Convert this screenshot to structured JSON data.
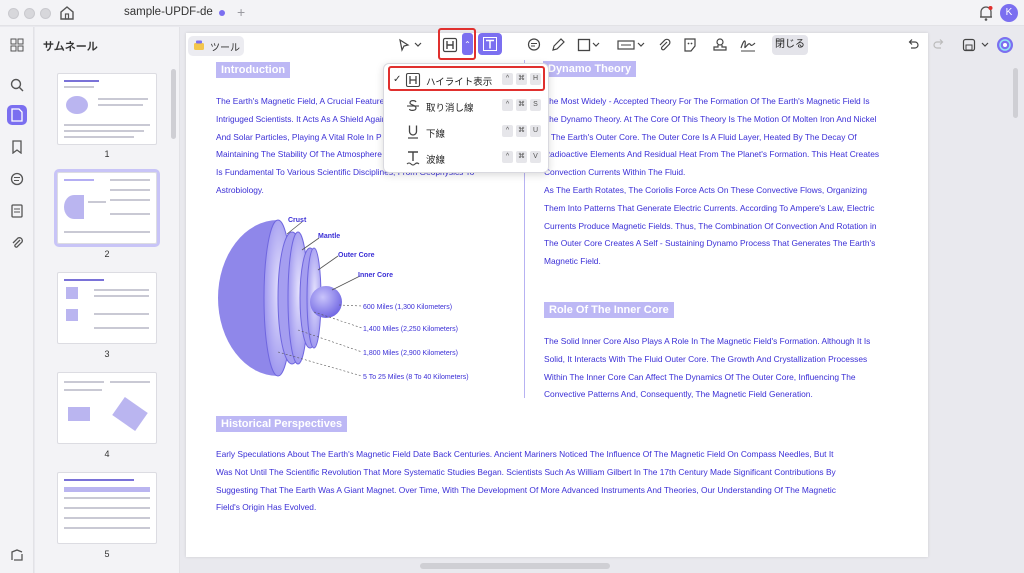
{
  "window": {
    "tab_title": "sample-UPDF-de",
    "avatar_letter": "K"
  },
  "sidebar": {
    "title": "サムネール",
    "pages": [
      "1",
      "2",
      "3",
      "4",
      "5"
    ]
  },
  "toolbar": {
    "tool_label": "ツール",
    "close_label": "閉じる"
  },
  "highlight_menu": {
    "items": [
      {
        "label": "ハイライト表示",
        "checked": true,
        "keys": [
          "^",
          "⌘",
          "H"
        ]
      },
      {
        "label": "取り消し線",
        "checked": false,
        "keys": [
          "^",
          "⌘",
          "S"
        ]
      },
      {
        "label": "下線",
        "checked": false,
        "keys": [
          "^",
          "⌘",
          "U"
        ]
      },
      {
        "label": "波線",
        "checked": false,
        "keys": [
          "^",
          "⌘",
          "V"
        ]
      }
    ]
  },
  "document": {
    "intro": {
      "title": "Introduction",
      "lines": [
        "The Earth's Magnetic Field, A Crucial Feature",
        "Intriguged Scientists. It Acts As A Shield Again",
        "And Solar Particles, Playing A Vital Role In P",
        "Maintaining The Stability Of The Atmosphere",
        "Is Fundamental To Various Scientific Disciplines, From Geophysics To",
        "Astrobiology."
      ]
    },
    "diagram": {
      "labels": {
        "crust": "Crust",
        "mantle": "Mantle",
        "outer_core": "Outer Core",
        "inner_core": "Inner Core"
      },
      "distances": [
        "600 Miles (1,300 Kilometers)",
        "1,400 Miles (2,250 Kilometers)",
        "1,800 Miles (2,900 Kilometers)",
        "5 To 25 Miles (8 To 40 Kilometers)"
      ]
    },
    "dynamo": {
      "title": "Dynamo Theory",
      "lines": [
        "The Most Widely - Accepted Theory For The Formation Of The Earth's Magnetic Field Is",
        "The Dynamo Theory. At The Core Of This Theory Is The Motion Of Molten Iron And Nickel",
        "n The Earth's Outer Core. The Outer Core Is A Fluid Layer, Heated By The Decay Of",
        "Radioactive Elements And Residual Heat From The Planet's Formation. This Heat Creates",
        "Convection Currents Within The Fluid.",
        "As The Earth Rotates, The Coriolis Force Acts On These Convective Flows, Organizing",
        "Them Into Patterns That Generate Electric Currents. According To Ampere's Law, Electric",
        "Currents Produce Magnetic Fields. Thus, The Combination Of Convection And Rotation in",
        "The Outer Core Creates A Self - Sustaining Dynamo Process That Generates The Earth's",
        "Magnetic Field."
      ]
    },
    "inner_core": {
      "title": "Role Of The Inner Core",
      "lines": [
        "The Solid Inner Core Also Plays A Role In The Magnetic Field's Formation. Although It Is",
        "Solid, It Interacts With The Fluid Outer Core. The Growth And Crystallization Processes",
        "Within The Inner Core Can Affect The Dynamics Of The Outer Core, Influencing The",
        "Convective Patterns And, Consequently, The Magnetic Field Generation."
      ]
    },
    "historical": {
      "title": "Historical Perspectives",
      "lines": [
        "Early Speculations About The Earth's Magnetic Field Date Back Centuries. Ancient Mariners Noticed The Influence Of The Magnetic Field On Compass Needles, But It",
        "Was Not Until The Scientific Revolution That More Systematic Studies Began. Scientists Such As William Gilbert In The 17th Century Made Significant Contributions By",
        "Suggesting That The Earth Was A Giant Magnet. Over Time, With The Development Of More Advanced Instruments And Theories, Our Understanding Of The Magnetic",
        "Field's Origin Has Evolved."
      ]
    }
  },
  "colors": {
    "accent": "#7b6ff0",
    "text_blue": "#3b2fd6",
    "highlight_red": "#e0302e",
    "section_bg": "#bdb8f5"
  }
}
